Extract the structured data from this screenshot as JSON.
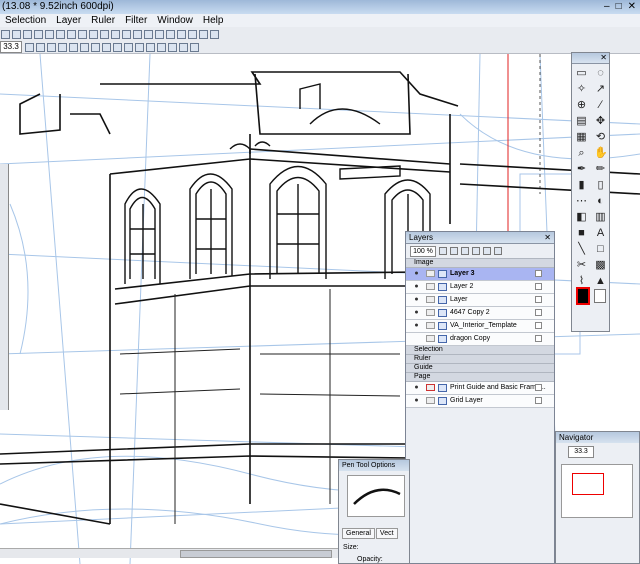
{
  "window": {
    "title": "(13.08 * 9.52inch 600dpi)",
    "controls": [
      "–",
      "□",
      "✕"
    ]
  },
  "menu": [
    "Selection",
    "Layer",
    "Ruler",
    "Filter",
    "Window",
    "Help"
  ],
  "toolbar": {
    "zoom": "33.3"
  },
  "layers_panel": {
    "title": "Layers",
    "opacity": "100 %",
    "groups": {
      "image": "Image",
      "selection": "Selection",
      "ruler": "Ruler",
      "guide": "Guide",
      "page": "Page"
    },
    "image_layers": [
      {
        "name": "Layer 3",
        "selected": true
      },
      {
        "name": "Layer 2",
        "selected": false
      },
      {
        "name": "Layer",
        "selected": false
      },
      {
        "name": "4647 Copy 2",
        "selected": false
      },
      {
        "name": "VA_Interior_Template",
        "selected": false
      },
      {
        "name": "dragon Copy",
        "selected": false
      }
    ],
    "page_layers": [
      {
        "name": "Print Guide and Basic Frame..."
      },
      {
        "name": "Grid Layer"
      }
    ]
  },
  "navigator": {
    "title": "Navigator",
    "zoom": "33.3"
  },
  "pen_tool_options": {
    "title": "Pen Tool Options",
    "tab_general": "General",
    "tab_vector": "Vect",
    "size_label": "Size:",
    "opacity_label": "Opacity:"
  },
  "icons": {
    "eye": "eye-icon",
    "lock": "lock-icon",
    "layer": "layer-icon"
  },
  "colors": {
    "selected_layer": "#a9b5f2",
    "foreground": "#000000",
    "swatch_border": "#e00000"
  }
}
